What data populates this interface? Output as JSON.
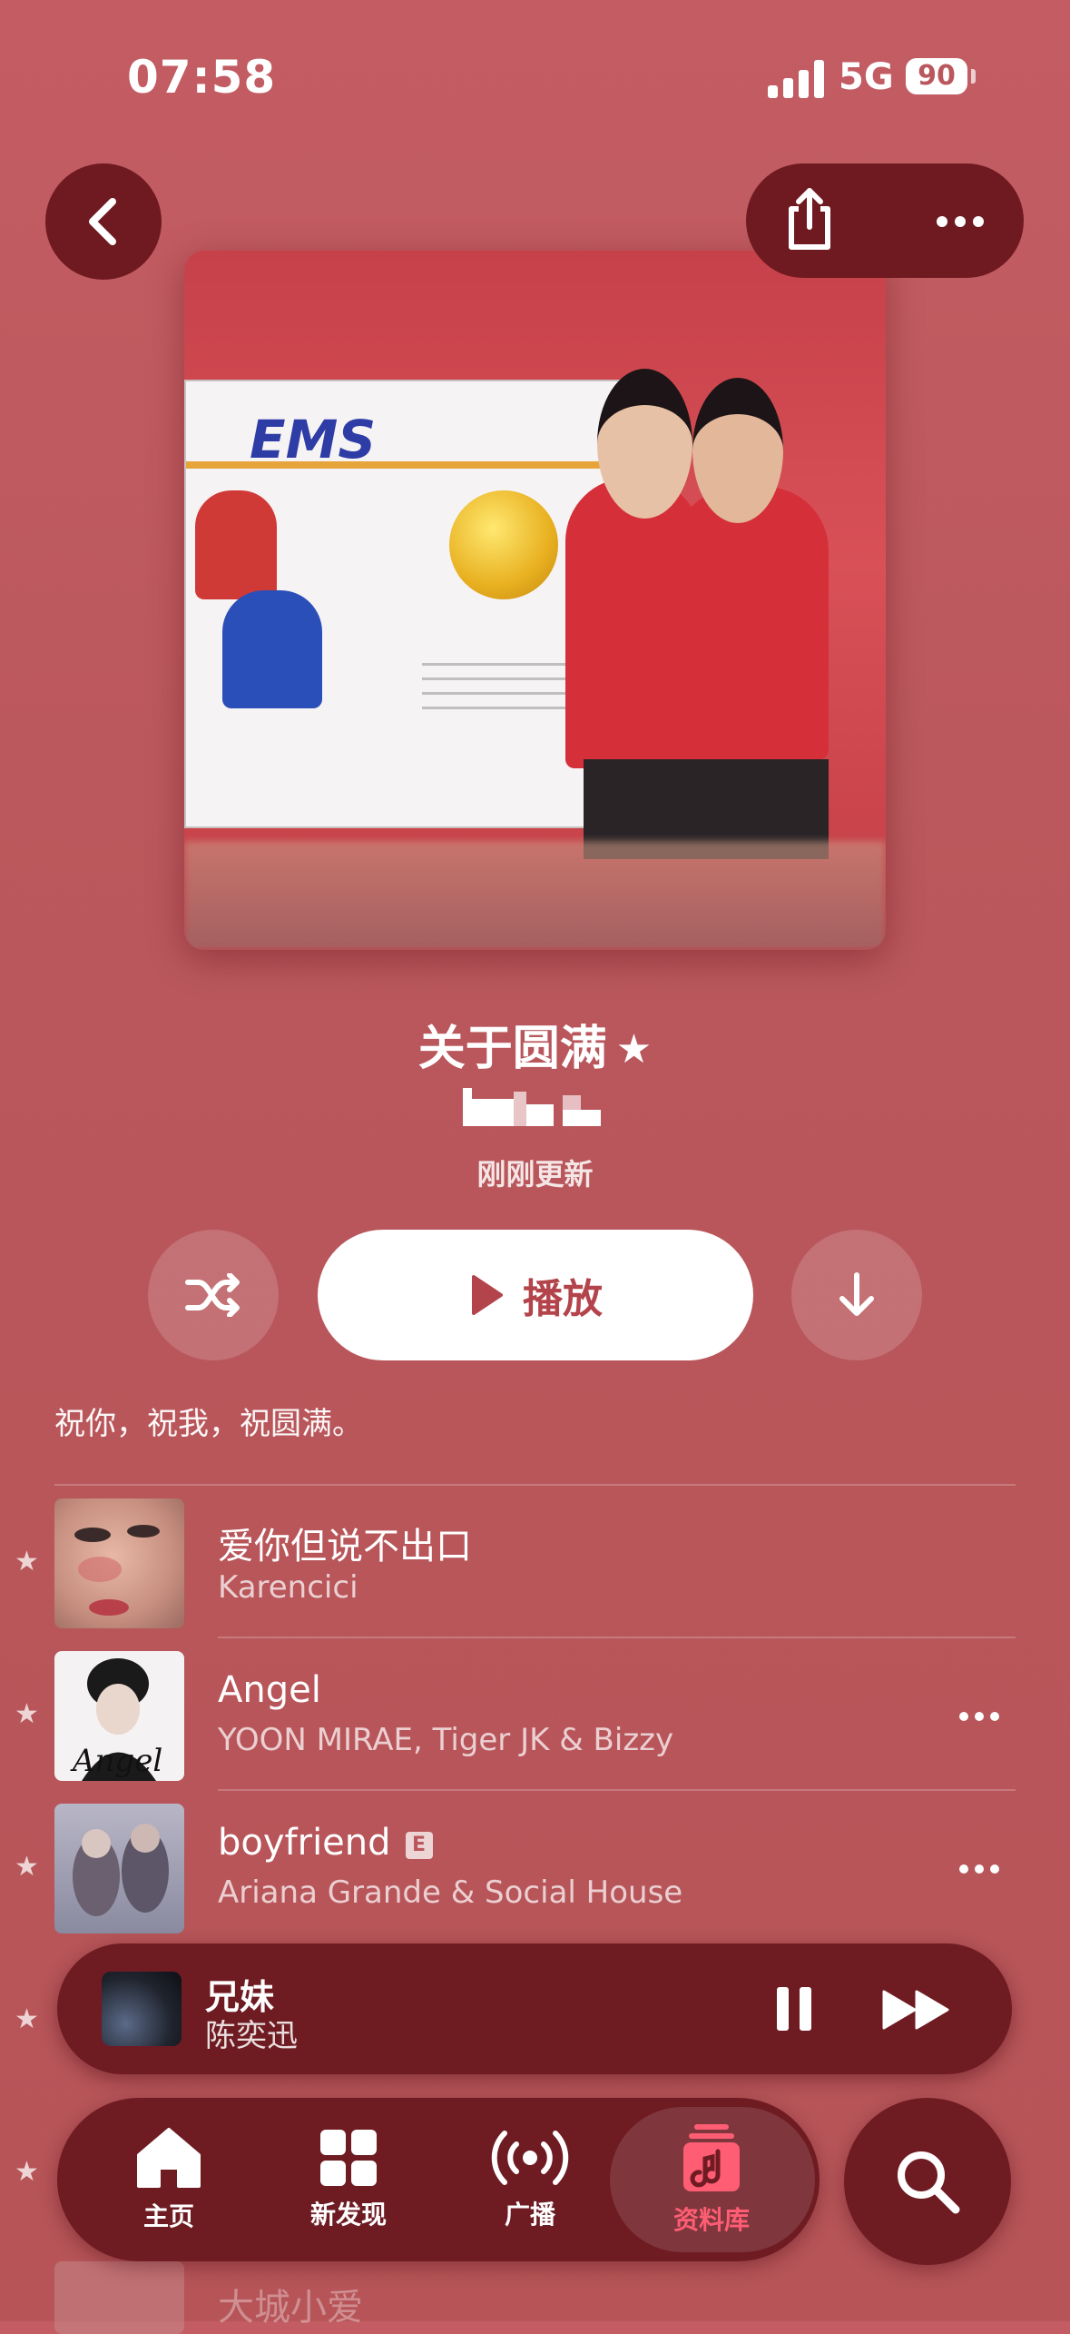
{
  "status_bar": {
    "time": "07:58",
    "network": "5G",
    "battery": "90"
  },
  "playlist": {
    "title": "关于圆满",
    "updated": "刚刚更新",
    "description": "祝你，祝我，祝圆满。",
    "play_label": "播放"
  },
  "tracks": [
    {
      "title": "爱你但说不出口",
      "artist": "Karencici",
      "starred": true,
      "explicit": false
    },
    {
      "title": "Angel",
      "artist": "YOON MIRAE, Tiger JK & Bizzy",
      "starred": true,
      "explicit": false
    },
    {
      "title": "boyfriend",
      "artist": "Ariana Grande & Social House",
      "starred": true,
      "explicit": true,
      "explicit_badge": "E"
    }
  ],
  "peek_track": {
    "title": "大城小爱"
  },
  "now_playing": {
    "title": "兄妹",
    "artist": "陈奕迅"
  },
  "tabs": [
    {
      "label": "主页",
      "icon": "home-icon"
    },
    {
      "label": "新发现",
      "icon": "grid-icon"
    },
    {
      "label": "广播",
      "icon": "radio-icon"
    },
    {
      "label": "资料库",
      "icon": "library-icon",
      "active": true
    }
  ],
  "colors": {
    "background": "#b9575c",
    "control_dark": "#6e1b22",
    "accent_active": "#ff5d74",
    "play_text": "#b3444b"
  },
  "icons": [
    "back-icon",
    "share-icon",
    "more-icon",
    "shuffle-icon",
    "play-icon",
    "download-icon",
    "pause-icon",
    "fast-forward-icon",
    "search-icon",
    "star-icon"
  ]
}
